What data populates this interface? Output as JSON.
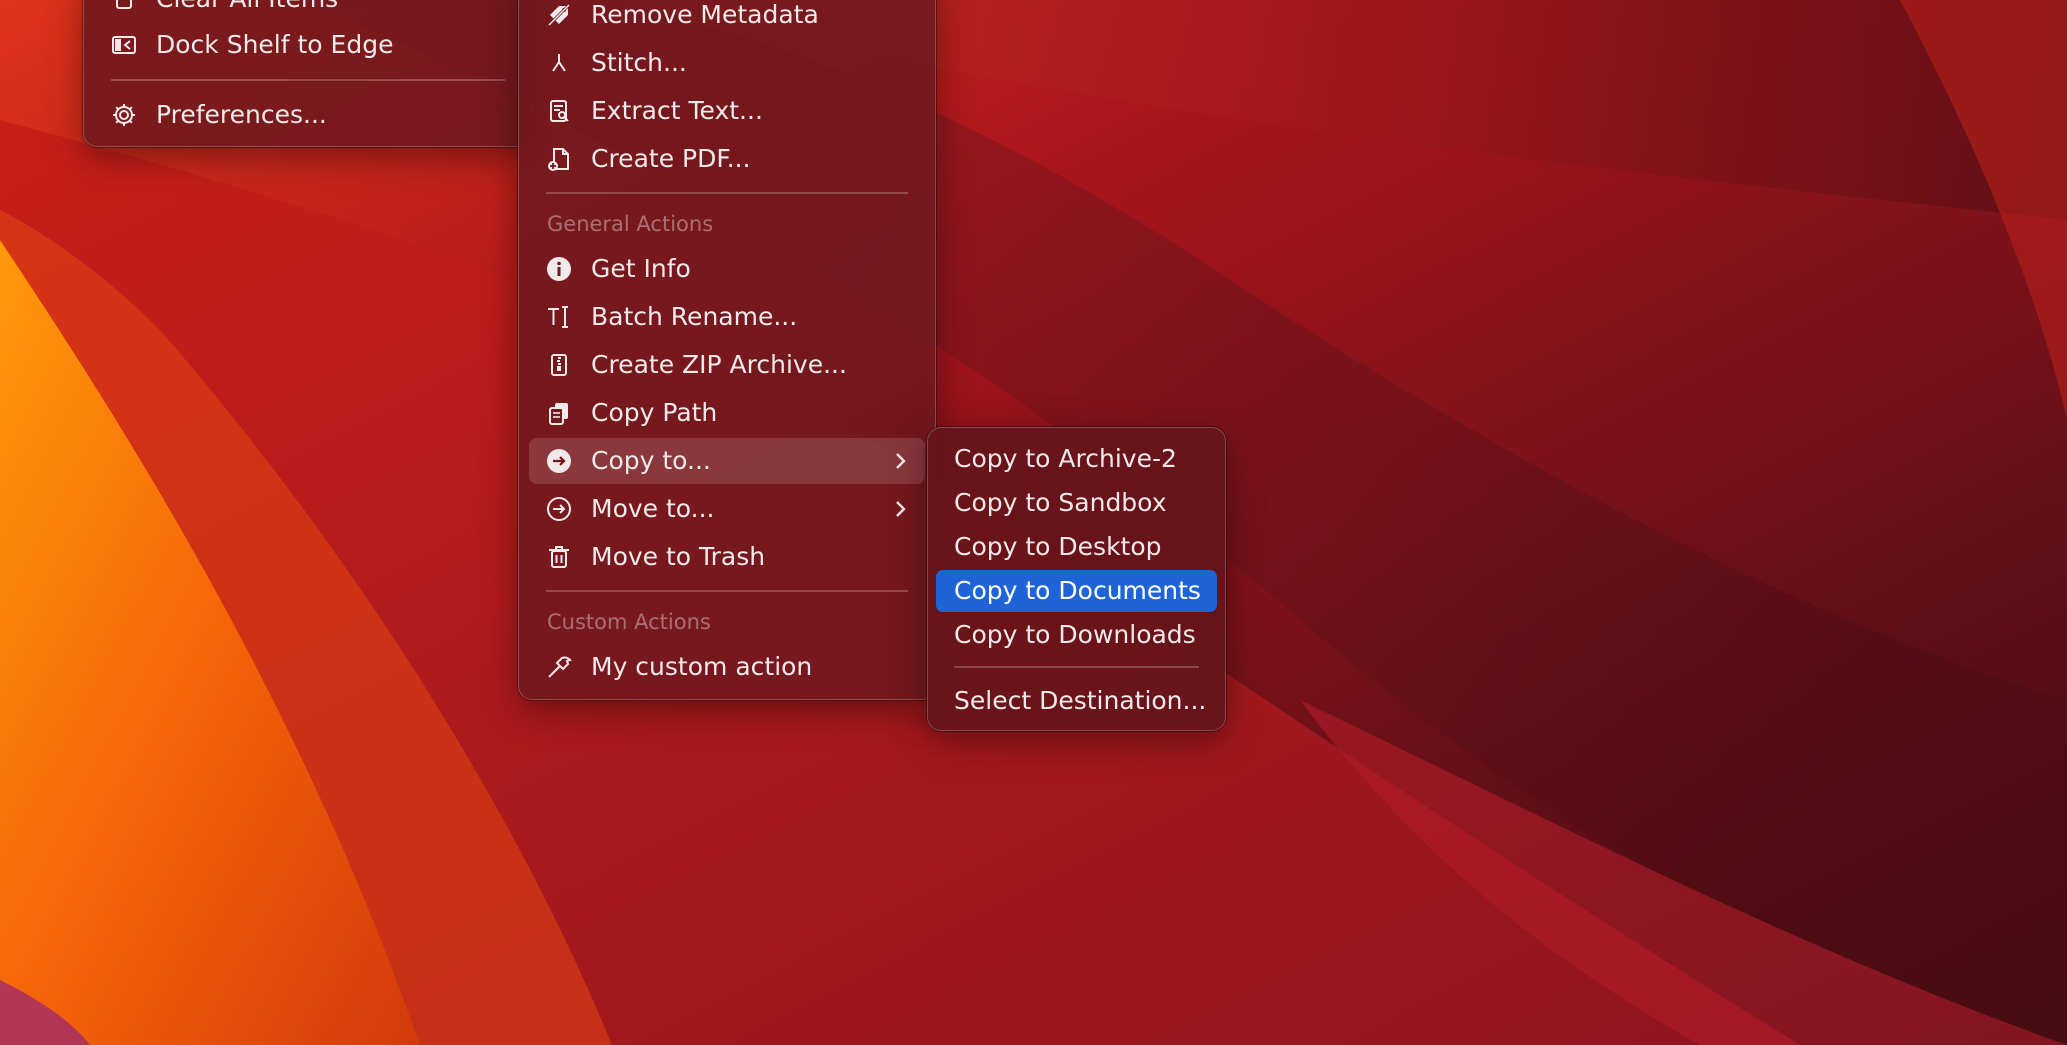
{
  "colors": {
    "menu_background": "#70181e",
    "selection_blue": "#1f64d6",
    "text": "#f2e9ea",
    "section_header_text": "#9d7f82"
  },
  "main_menu": {
    "items": [
      {
        "label": "Clear All Items",
        "icon": "trash-icon"
      },
      {
        "label": "Dock Shelf to Edge",
        "icon": "dock-edge-icon"
      },
      {
        "label": "Preferences...",
        "icon": "gear-icon"
      }
    ]
  },
  "actions_menu": {
    "top_items": [
      {
        "label": "Remove Metadata",
        "icon": "remove-metadata-icon"
      },
      {
        "label": "Stitch...",
        "icon": "stitch-icon"
      },
      {
        "label": "Extract Text...",
        "icon": "extract-text-icon"
      },
      {
        "label": "Create PDF...",
        "icon": "create-pdf-icon"
      }
    ],
    "general_header": "General Actions",
    "general_items": [
      {
        "label": "Get Info",
        "icon": "info-icon"
      },
      {
        "label": "Batch Rename...",
        "icon": "rename-icon"
      },
      {
        "label": "Create ZIP Archive...",
        "icon": "zip-icon"
      },
      {
        "label": "Copy Path",
        "icon": "copy-path-icon"
      },
      {
        "label": "Copy to...",
        "icon": "copy-to-icon",
        "submenu": true,
        "hovered": true
      },
      {
        "label": "Move to...",
        "icon": "move-to-icon",
        "submenu": true
      },
      {
        "label": "Move to Trash",
        "icon": "trash-icon"
      }
    ],
    "custom_header": "Custom Actions",
    "custom_items": [
      {
        "label": "My custom action",
        "icon": "hammer-icon"
      }
    ]
  },
  "copy_submenu": {
    "items": [
      {
        "label": "Copy to Archive-2"
      },
      {
        "label": "Copy to Sandbox"
      },
      {
        "label": "Copy to Desktop"
      },
      {
        "label": "Copy to Documents",
        "selected": true
      },
      {
        "label": "Copy to Downloads"
      }
    ],
    "select_destination": "Select Destination..."
  }
}
